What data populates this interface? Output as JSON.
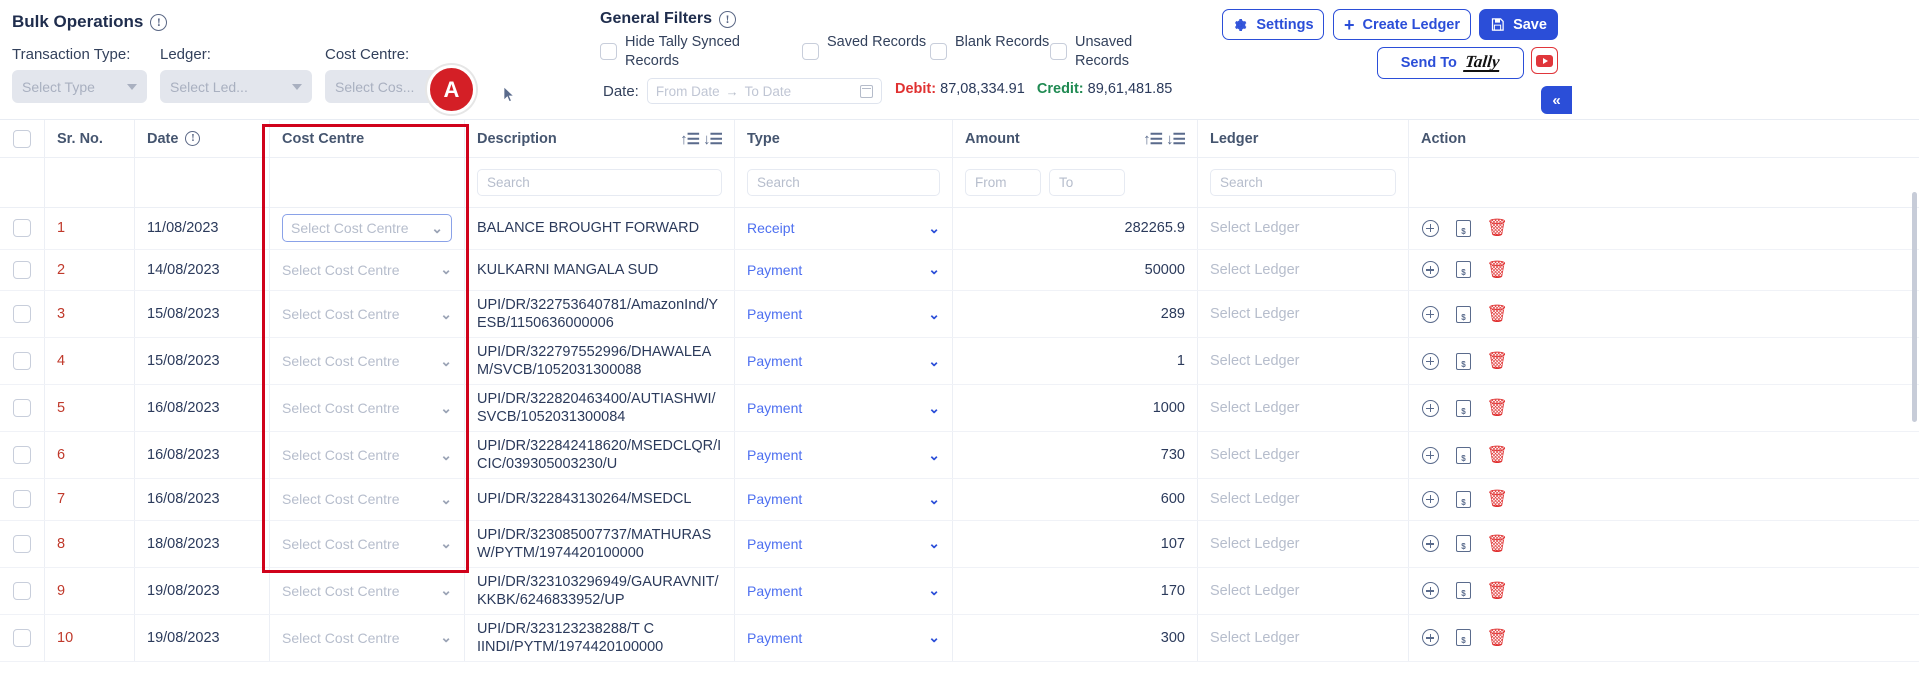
{
  "bulk": {
    "title": "Bulk Operations",
    "info_icon": "info-icon",
    "transaction_type_label": "Transaction Type:",
    "ledger_label": "Ledger:",
    "cost_centre_label": "Cost Centre:",
    "transaction_type_value": "Select Type",
    "ledger_value": "Select Led...",
    "cost_centre_value": "Select Cos...",
    "avatar_initial": "A"
  },
  "general_filters": {
    "title": "General Filters",
    "checkboxes": [
      {
        "label": "Hide Tally Synced Records",
        "checked": false
      },
      {
        "label": "Saved Records",
        "checked": false
      },
      {
        "label": "Blank Records",
        "checked": false
      },
      {
        "label": "Unsaved Records",
        "checked": false
      }
    ],
    "date_label": "Date:",
    "from_placeholder": "From Date",
    "date_arrow": "→",
    "to_placeholder": "To Date",
    "debit_label": "Debit:",
    "debit_value": "87,08,334.91",
    "credit_label": "Credit:",
    "credit_value": "89,61,481.85",
    "debit_color": "#e03131",
    "credit_color": "#1f8a52"
  },
  "toolbar": {
    "settings_label": "Settings",
    "create_ledger_label": "Create Ledger",
    "create_ledger_icon": "plus-icon",
    "save_label": "Save",
    "save_icon": "save-disk-icon",
    "send_to_label": "Send To",
    "send_to_brand": "Tally",
    "youtube_icon": "youtube-icon",
    "collapse_icon": "«",
    "accent_color": "#2b4ed8"
  },
  "table": {
    "columns": [
      {
        "key": "check",
        "label": ""
      },
      {
        "key": "sr",
        "label": "Sr. No."
      },
      {
        "key": "date",
        "label": "Date",
        "info": true
      },
      {
        "key": "cost_centre",
        "label": "Cost Centre"
      },
      {
        "key": "description",
        "label": "Description",
        "sortable": true
      },
      {
        "key": "type",
        "label": "Type"
      },
      {
        "key": "amount",
        "label": "Amount",
        "sortable": true
      },
      {
        "key": "ledger",
        "label": "Ledger"
      },
      {
        "key": "action",
        "label": "Action"
      }
    ],
    "filters": {
      "description_placeholder": "Search",
      "type_placeholder": "Search",
      "amount_from_placeholder": "From",
      "amount_to_placeholder": "To",
      "ledger_placeholder": "Search"
    },
    "placeholders": {
      "cost_centre": "Select Cost Centre",
      "ledger": "Select Ledger"
    },
    "sort_asc_icon": "sort-ascending-icon",
    "sort_desc_icon": "sort-descending-icon",
    "action_icons": [
      "add-circle-icon",
      "split-sheet-icon",
      "delete-icon"
    ],
    "rows": [
      {
        "sr": "1",
        "date": "11/08/2023",
        "cost_centre": "Select Cost Centre",
        "description": "BALANCE BROUGHT FORWARD",
        "type": "Receipt",
        "amount": "282265.9",
        "ledger": "Select Ledger"
      },
      {
        "sr": "2",
        "date": "14/08/2023",
        "cost_centre": "Select Cost Centre",
        "description": "KULKARNI MANGALA SUD",
        "type": "Payment",
        "amount": "50000",
        "ledger": "Select Ledger"
      },
      {
        "sr": "3",
        "date": "15/08/2023",
        "cost_centre": "Select Cost Centre",
        "description": "UPI/DR/322753640781/AmazonInd/YESB/1150636000006",
        "type": "Payment",
        "amount": "289",
        "ledger": "Select Ledger"
      },
      {
        "sr": "4",
        "date": "15/08/2023",
        "cost_centre": "Select Cost Centre",
        "description": "UPI/DR/322797552996/DHAWALEAM/SVCB/1052031300088",
        "type": "Payment",
        "amount": "1",
        "ledger": "Select Ledger"
      },
      {
        "sr": "5",
        "date": "16/08/2023",
        "cost_centre": "Select Cost Centre",
        "description": "UPI/DR/322820463400/AUTIASHWI/SVCB/1052031300084",
        "type": "Payment",
        "amount": "1000",
        "ledger": "Select Ledger"
      },
      {
        "sr": "6",
        "date": "16/08/2023",
        "cost_centre": "Select Cost Centre",
        "description": "UPI/DR/322842418620/MSEDCLQR/ICIC/039305003230/U",
        "type": "Payment",
        "amount": "730",
        "ledger": "Select Ledger"
      },
      {
        "sr": "7",
        "date": "16/08/2023",
        "cost_centre": "Select Cost Centre",
        "description": "UPI/DR/322843130264/MSEDCL",
        "type": "Payment",
        "amount": "600",
        "ledger": "Select Ledger"
      },
      {
        "sr": "8",
        "date": "18/08/2023",
        "cost_centre": "Select Cost Centre",
        "description": "UPI/DR/323085007737/MATHURASW/PYTM/1974420100000",
        "type": "Payment",
        "amount": "107",
        "ledger": "Select Ledger"
      },
      {
        "sr": "9",
        "date": "19/08/2023",
        "cost_centre": "Select Cost Centre",
        "description": "UPI/DR/323103296949/GAURAVNIT/KKBK/6246833952/UP",
        "type": "Payment",
        "amount": "170",
        "ledger": "Select Ledger"
      },
      {
        "sr": "10",
        "date": "19/08/2023",
        "cost_centre": "Select Cost Centre",
        "description": "UPI/DR/323123238288/T C IINDI/PYTM/1974420100000",
        "type": "Payment",
        "amount": "300",
        "ledger": "Select Ledger"
      }
    ]
  }
}
